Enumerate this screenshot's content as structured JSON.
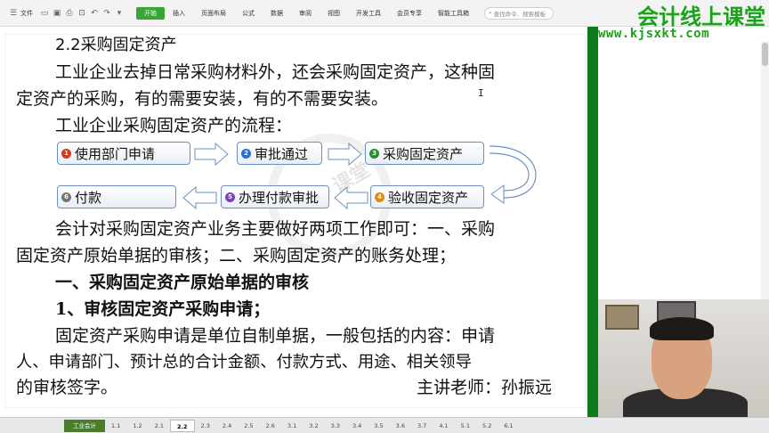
{
  "toolbar": {
    "file_menu": "文件",
    "tabs": [
      {
        "label": "开始",
        "active": true
      },
      {
        "label": "插入",
        "active": false
      },
      {
        "label": "页面布局",
        "active": false
      },
      {
        "label": "公式",
        "active": false
      },
      {
        "label": "数据",
        "active": false
      },
      {
        "label": "审阅",
        "active": false
      },
      {
        "label": "视图",
        "active": false
      },
      {
        "label": "开发工具",
        "active": false
      },
      {
        "label": "会员专享",
        "active": false
      },
      {
        "label": "智能工具箱",
        "active": false
      }
    ],
    "search_placeholder": "查找命令、搜索模板",
    "active_color": "#3aa435"
  },
  "brand": {
    "name": "会计线上课堂",
    "url": "www.kjsxkt.com",
    "color": "#1aa31a"
  },
  "document": {
    "heading": "2.2采购固定资产",
    "para1_line1": "工业企业去掉日常采购材料外，还会采购固定资产，这种固",
    "para1_line2": "定资产的采购，有的需要安装，有的不需要安装。",
    "para2": "工业企业采购固定资产的流程：",
    "flow": {
      "steps": [
        {
          "num": "1",
          "label": "使用部门申请",
          "color": "#d63a1c"
        },
        {
          "num": "2",
          "label": "审批通过",
          "color": "#2d6fd1"
        },
        {
          "num": "3",
          "label": "采购固定资产",
          "color": "#2d8a2d"
        },
        {
          "num": "4",
          "label": "验收固定资产",
          "color": "#e08a1a"
        },
        {
          "num": "5",
          "label": "办理付款审批",
          "color": "#7d3fc4"
        },
        {
          "num": "6",
          "label": "付款",
          "color": "#777777"
        }
      ]
    },
    "para3_line1": "会计对采购固定资产业务主要做好两项工作即可：一、采购",
    "para3_line2": "固定资产原始单据的审核；二、采购固定资产的账务处理；",
    "section1": "一、采购固定资产原始单据的审核",
    "sub1": "1、审核固定资产采购申请；",
    "para4_line1": "固定资产采购申请是单位自制单据，一般包括的内容：申请",
    "para4_line2": "人、申请部门、预计总的合计金额、付款方式、用途、相关领导",
    "para4_line3": "的审核签字。",
    "teacher": "主讲老师：孙振远"
  },
  "sheet_tabs": [
    "工业会计",
    "1.1",
    "1.2",
    "2.1",
    "2.2",
    "2.3",
    "2.4",
    "2.5",
    "2.6",
    "3.1",
    "3.2",
    "3.3",
    "3.4",
    "3.5",
    "3.6",
    "3.7",
    "4.1",
    "5.1",
    "5.2",
    "6.1"
  ],
  "active_sheet": "2.2"
}
